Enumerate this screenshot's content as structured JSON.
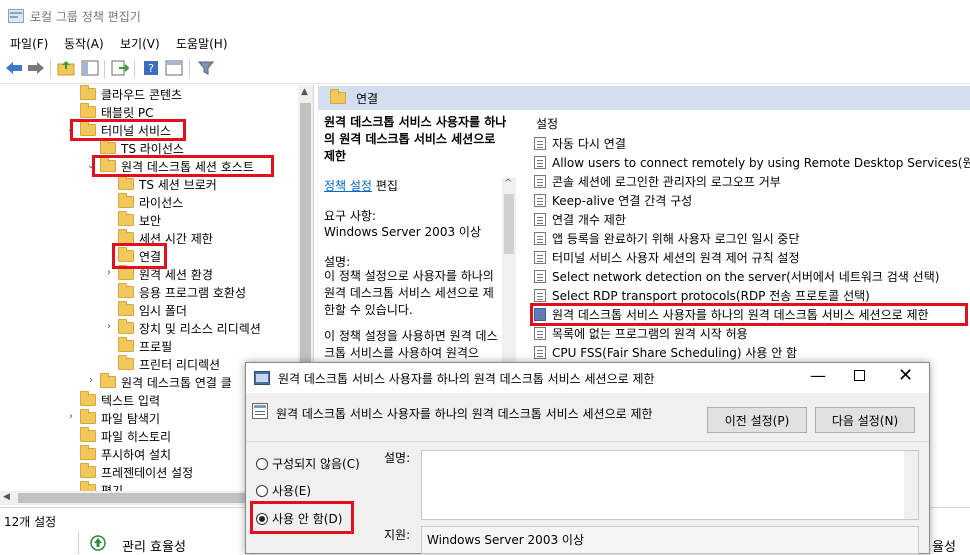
{
  "window": {
    "title": "로컬 그룹 정책 편집기"
  },
  "menu": {
    "file": "파일(F)",
    "action": "동작(A)",
    "view": "보기(V)",
    "help": "도움말(H)"
  },
  "tree": {
    "items": [
      {
        "label": "클라우드 콘텐츠"
      },
      {
        "label": "태블릿 PC"
      },
      {
        "label": "터미널 서비스"
      },
      {
        "label": "TS 라이선스"
      },
      {
        "label": "원격 데스크톱 세션 호스트"
      },
      {
        "label": "TS 세션 브로커"
      },
      {
        "label": "라이선스"
      },
      {
        "label": "보안"
      },
      {
        "label": "세션 시간 제한"
      },
      {
        "label": "연결"
      },
      {
        "label": "원격 세션 환경"
      },
      {
        "label": "응용 프로그램 호환성"
      },
      {
        "label": "임시 폴더"
      },
      {
        "label": "장치 및 리소스 리디렉션"
      },
      {
        "label": "프로필"
      },
      {
        "label": "프린터 리디렉션"
      },
      {
        "label": "원격 데스크톱 연결 클"
      },
      {
        "label": "텍스트 입력"
      },
      {
        "label": "파일 탐색기"
      },
      {
        "label": "파일 히스토리"
      },
      {
        "label": "푸시하여 설치"
      },
      {
        "label": "프레젠테이션 설정"
      },
      {
        "label": "편기"
      }
    ]
  },
  "right_pane": {
    "header": "연결",
    "desc_title": "원격 데스크톱 서비스 사용자를 하나의 원격 데스크톱 서비스 세션으로 제한",
    "policy_link": "정책 설정",
    "edit_text": "편집",
    "req_label": "요구 사항:",
    "req_value": "Windows Server 2003 이상",
    "desc_label": "설명:",
    "desc_text1": "이 정책 설정으로 사용자를 하나의 원격 데스크톱 서비스 세션으로 제한할 수 있습니다.",
    "desc_text2": "이 정책 설정을 사용하면 원격 데스크톱 서비스를 사용하여 원격으",
    "settings_header": "설정",
    "settings": [
      {
        "label": "자동 다시 연결"
      },
      {
        "label": "Allow users to connect remotely by using Remote Desktop Services(원격 ..."
      },
      {
        "label": "콘솔 세션에 로그인한 관리자의 로그오프 거부"
      },
      {
        "label": "Keep-alive 연결 간격 구성"
      },
      {
        "label": "연결 개수 제한"
      },
      {
        "label": "앱 등록을 완료하기 위해 사용자 로그인 일시 중단"
      },
      {
        "label": "터미널 서비스 사용자 세션의 원격 제어 규칙 설정"
      },
      {
        "label": "Select network detection on the server(서버에서 네트워크 검색 선택)"
      },
      {
        "label": "Select RDP transport protocols(RDP 전송 프로토콜 선택)"
      },
      {
        "label": "원격 데스크톱 서비스 사용자를 하나의 원격 데스크톱 서비스 세션으로 제한"
      },
      {
        "label": "목록에 없는 프로그램의 원격 시작 허용"
      },
      {
        "label": "CPU FSS(Fair Share Scheduling) 사용 안 함"
      }
    ]
  },
  "status": {
    "count": "12개 설정",
    "bottom_label": "관리 효율성",
    "bottom_right": "율성"
  },
  "dialog": {
    "title": "원격 데스크톱 서비스 사용자를 하나의 원격 데스크톱 서비스 세션으로 제한",
    "subtitle": "원격 데스크톱 서비스 사용자를 하나의 원격 데스크톱 서비스 세션으로 제한",
    "prev_button": "이전 설정(P)",
    "next_button": "다음 설정(N)",
    "radio_not_configured": "구성되지 않음(C)",
    "radio_enabled": "사용(E)",
    "radio_disabled": "사용 안 함(D)",
    "comment_label": "설명:",
    "supported_label": "지원:",
    "supported_value": "Windows Server 2003 이상"
  },
  "colors": {
    "highlight": "#e0111d",
    "header_bg": "#d3dfee",
    "link": "#0066cc"
  }
}
